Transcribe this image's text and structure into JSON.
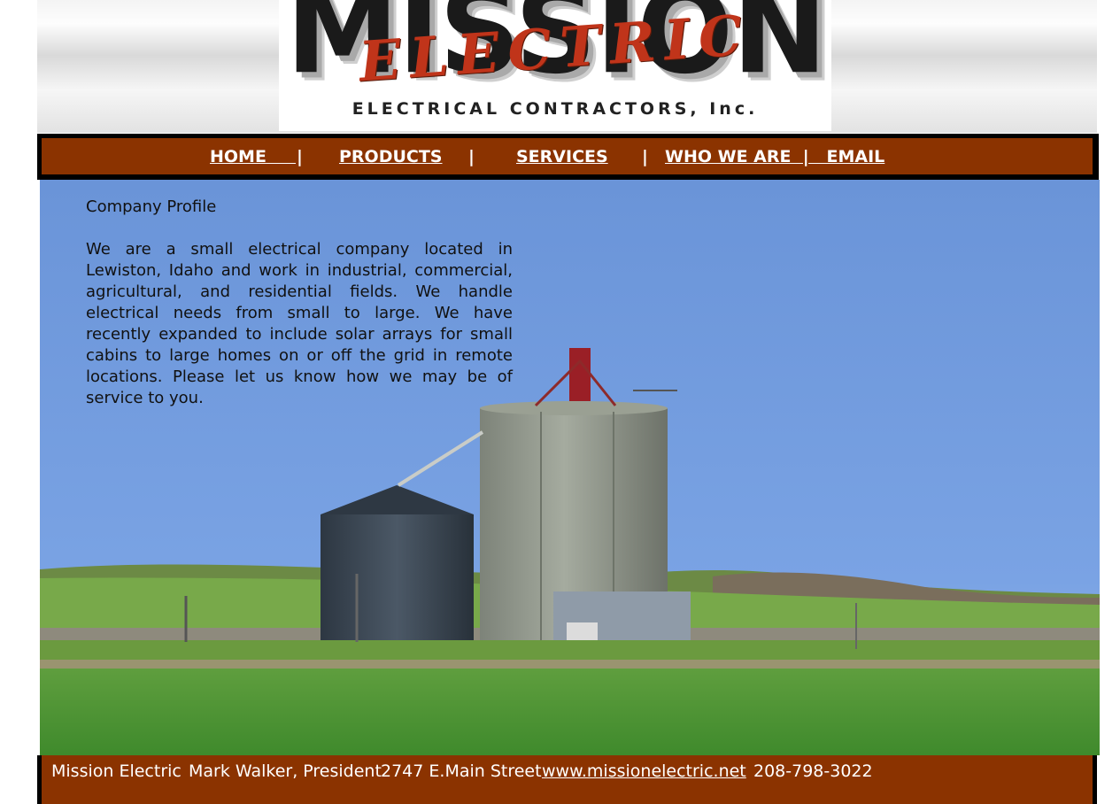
{
  "logo": {
    "main_word": "MISSION",
    "overlay_word": "ELECTRIC",
    "tagline": "ELECTRICAL CONTRACTORS, Inc."
  },
  "nav": {
    "home": "HOME     ",
    "sep1": "|",
    "products": "PRODUCTS",
    "sep2": "|",
    "services": "SERVICES",
    "sep3": "|",
    "who_we_are": "WHO WE ARE  |   EMAIL"
  },
  "profile": {
    "title": "Company Profile",
    "text": "We are a small electrical company located in Lewiston, Idaho and work in industrial, commercial, agricultural, and residential fields. We handle electrical needs from small to large. We have recently expanded to include solar arrays for small cabins to large homes on or off the grid in remote locations. Please let us know how we may be of service to you."
  },
  "footer": {
    "company": "Mission Electric",
    "contact": "Mark Walker, President",
    "address": "2747 E.Main Street",
    "website": "www.missionelectric.net",
    "phone": "208-798-3022"
  },
  "colors": {
    "nav_bg": "#8b3300",
    "border": "#000000",
    "sky": "#6f97d6",
    "grass": "#4f9d3d"
  }
}
